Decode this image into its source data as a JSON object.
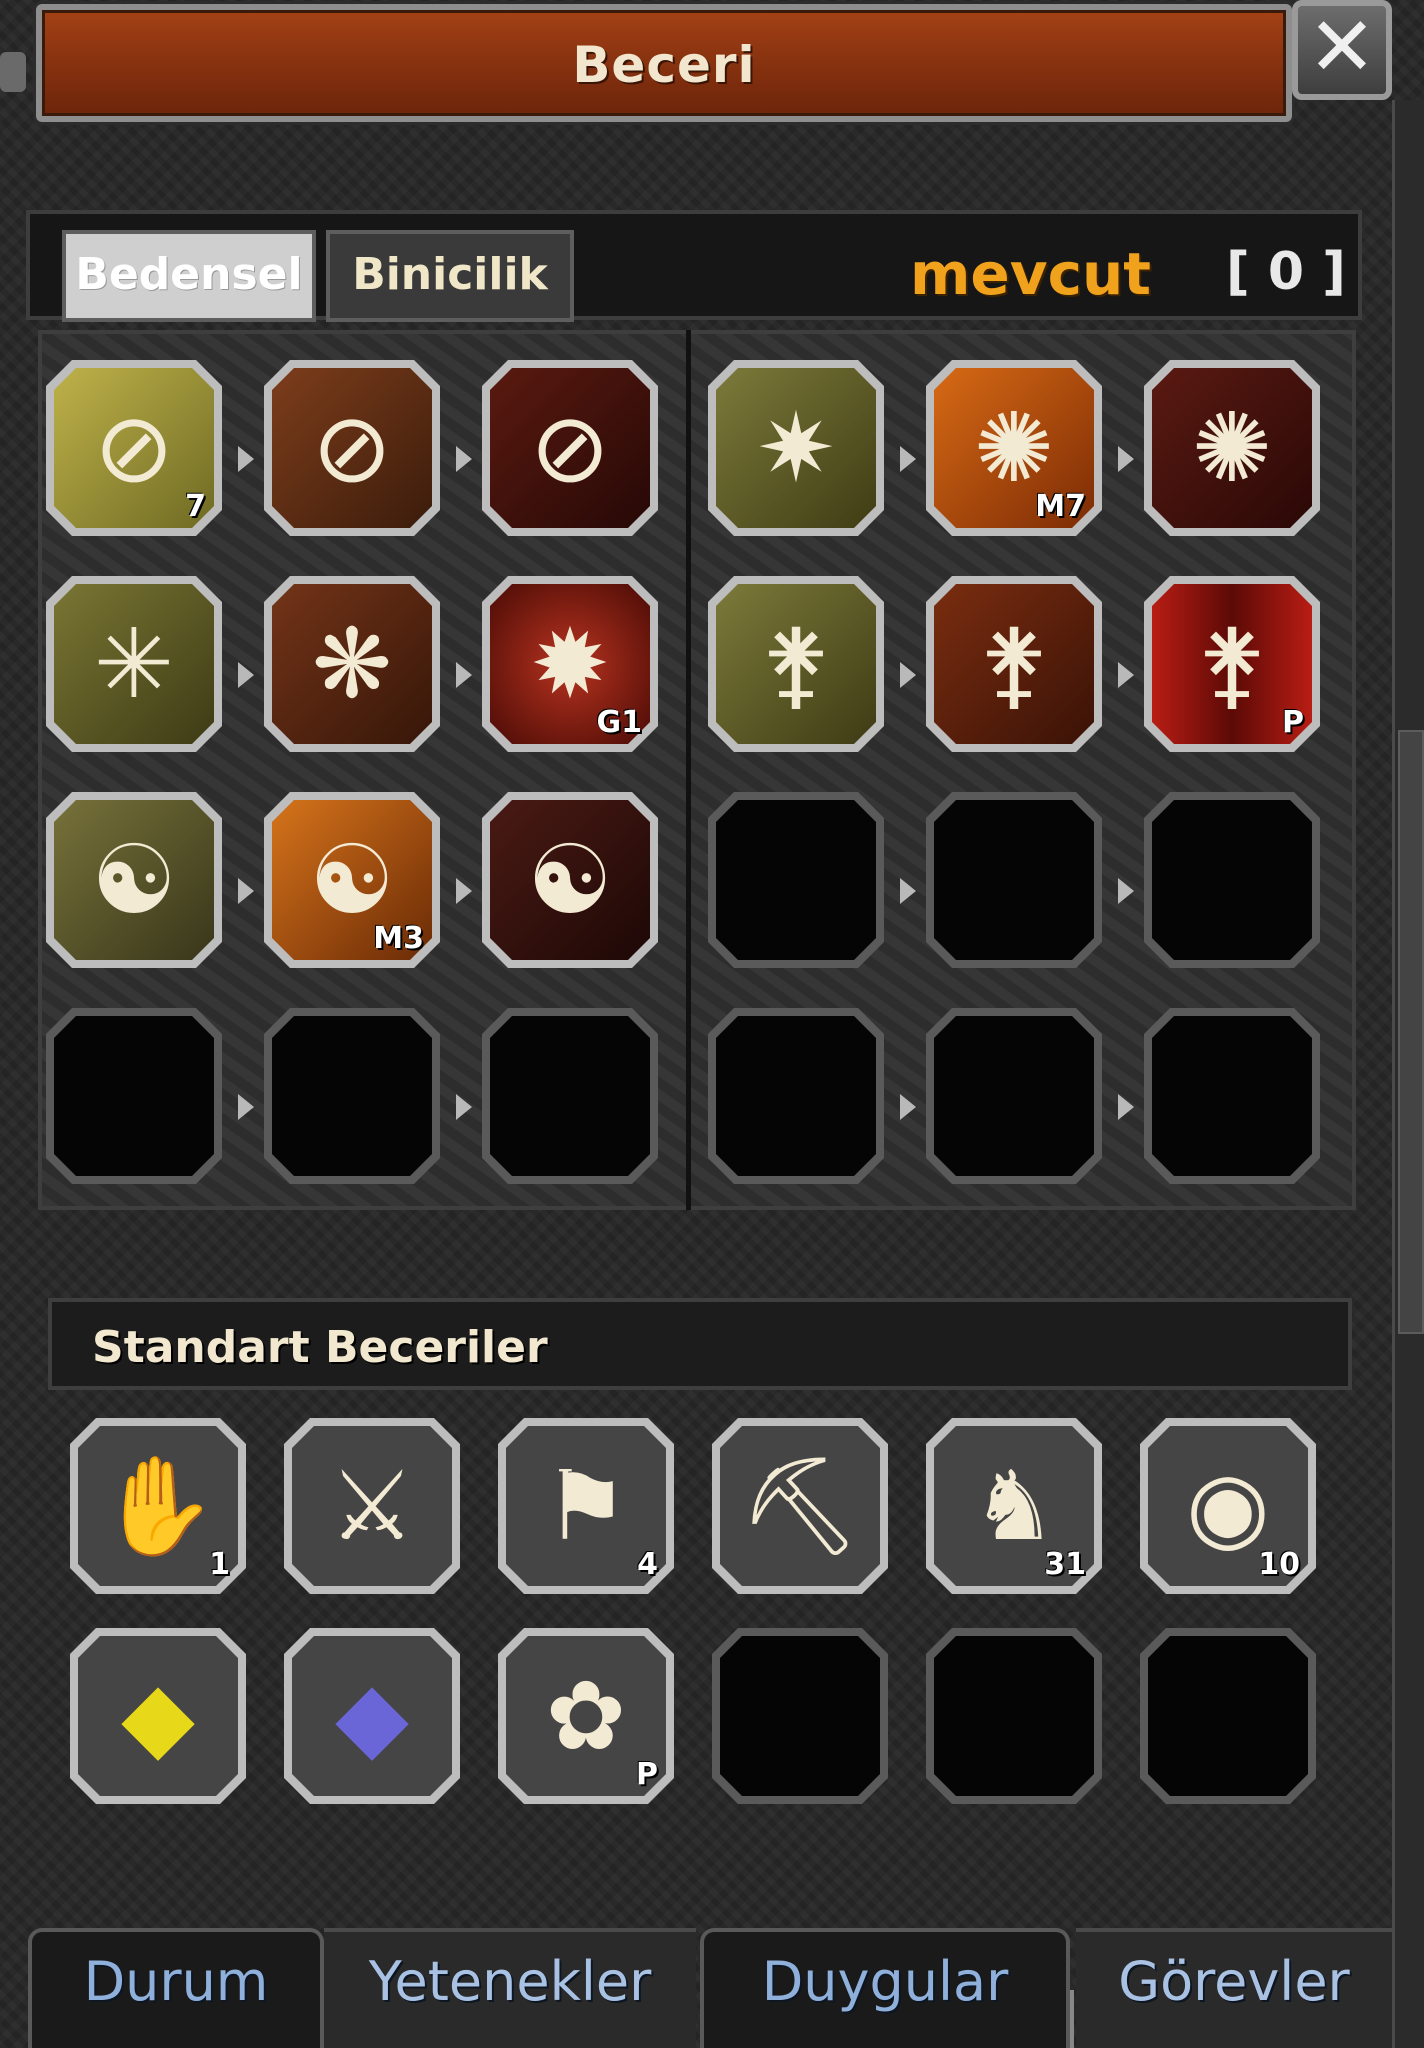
{
  "window": {
    "title": "Beceri",
    "close_icon": "close-icon"
  },
  "tabs": {
    "bedensel": "Bedensel",
    "binicilik": "Binicilik"
  },
  "points": {
    "label": "mevcut",
    "value": "[ 0 ]"
  },
  "skills": [
    {
      "icon": "slash-icon",
      "level": "7"
    },
    {
      "icon": "double-slash-icon",
      "level": ""
    },
    {
      "icon": "triple-slash-icon",
      "level": ""
    },
    {
      "icon": "whirl-burst-icon",
      "level": ""
    },
    {
      "icon": "whirl-burst-icon",
      "level": "M7"
    },
    {
      "icon": "whirl-burst-icon",
      "level": ""
    },
    {
      "icon": "claw-burst-icon",
      "level": ""
    },
    {
      "icon": "claw-burst-icon",
      "level": ""
    },
    {
      "icon": "sun-burst-icon",
      "level": "G1"
    },
    {
      "icon": "sword-feather-icon",
      "level": ""
    },
    {
      "icon": "sword-feather-icon",
      "level": ""
    },
    {
      "icon": "sword-feather-icon",
      "level": "P"
    },
    {
      "icon": "orb-swirl-icon",
      "level": ""
    },
    {
      "icon": "orb-swirl-icon",
      "level": "M3"
    },
    {
      "icon": "orb-swirl-icon",
      "level": ""
    }
  ],
  "standard": {
    "title": "Standart Beceriler",
    "skills": [
      {
        "icon": "hand-slash-icon",
        "level": "1"
      },
      {
        "icon": "crossed-tools-icon",
        "level": ""
      },
      {
        "icon": "flag-icon",
        "level": "4"
      },
      {
        "icon": "pickaxe-icon",
        "level": ""
      },
      {
        "icon": "horse-icon",
        "level": "31"
      },
      {
        "icon": "moon-shield-icon",
        "level": "10"
      },
      {
        "icon": "yellow-gem-icon",
        "level": ""
      },
      {
        "icon": "blue-gem-icon",
        "level": ""
      },
      {
        "icon": "knot-flower-icon",
        "level": "P"
      }
    ]
  },
  "bottom_tabs": [
    "Durum",
    "Yetenekler",
    "Duygular",
    "Görevler"
  ]
}
